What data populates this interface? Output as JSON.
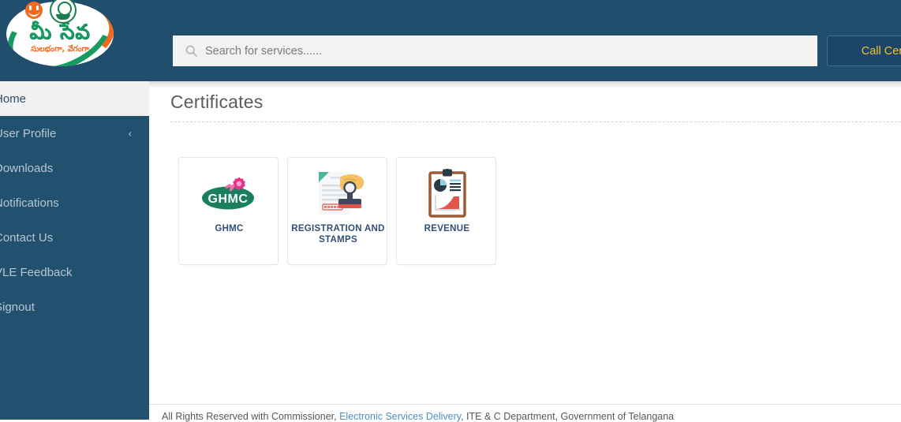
{
  "header": {
    "logo": {
      "main_text": "మీ సేవ",
      "sub_text": "సులభంగా, వేగంగా",
      "smiley_icon": "smiley-face-icon",
      "emblem_icon": "telangana-government-emblem-icon"
    },
    "search": {
      "placeholder": "Search for services......",
      "value": "",
      "icon": "search-icon"
    },
    "call_center_label": "Call Center"
  },
  "sidebar": {
    "items": [
      {
        "label": "Home",
        "active": true,
        "chevron": ""
      },
      {
        "label": "User Profile",
        "active": false,
        "chevron": "‹"
      },
      {
        "label": "Downloads",
        "active": false,
        "chevron": ""
      },
      {
        "label": "Notifications",
        "active": false,
        "chevron": ""
      },
      {
        "label": "Contact Us",
        "active": false,
        "chevron": ""
      },
      {
        "label": "VLE Feedback",
        "active": false,
        "chevron": ""
      },
      {
        "label": "Signout",
        "active": false,
        "chevron": ""
      }
    ]
  },
  "main": {
    "page_title": "Certificates",
    "cards": [
      {
        "label": "GHMC",
        "icon": "ghmc-logo-icon"
      },
      {
        "label": "REGISTRATION AND STAMPS",
        "icon": "stamp-document-icon"
      },
      {
        "label": "REVENUE",
        "icon": "clipboard-chart-icon"
      }
    ]
  },
  "footer": {
    "text_before": "All Rights Reserved with Commissioner,",
    "link_text": "Electronic Services Delivery",
    "text_after": ", ITE & C Department, Government of Telangana"
  },
  "colors": {
    "header_blue": "#224e6e",
    "sidebar_blue": "#22506f",
    "accent_yellow": "#f0c040",
    "card_label_blue": "#2f5075",
    "link_blue": "#4a90c4",
    "logo_green": "#169b62",
    "logo_orange": "#f26a21"
  }
}
